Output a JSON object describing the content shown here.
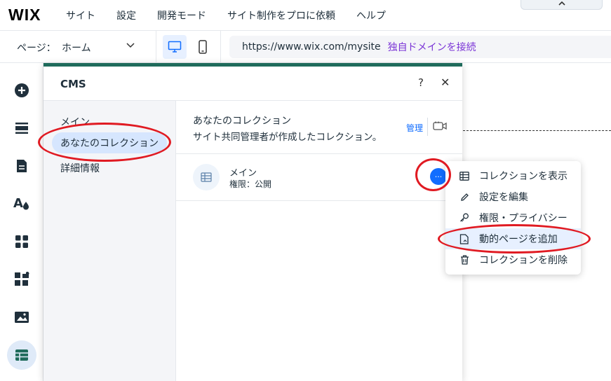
{
  "topbar": {
    "logo": "WIX",
    "menu": [
      "サイト",
      "設定",
      "開発モード",
      "サイト制作をプロに依頼",
      "ヘルプ"
    ],
    "collapse_icon": "chevron-up-icon"
  },
  "pagebar": {
    "page_label": "ページ：",
    "page_value": "ホーム",
    "url": "https://www.wix.com/mysite",
    "connect_domain": "独自ドメインを接続"
  },
  "rail": {
    "icons": [
      "add-icon",
      "sections-icon",
      "pages-icon",
      "design-icon",
      "apps-icon",
      "business-icon",
      "media-icon",
      "cms-icon"
    ]
  },
  "panel": {
    "title": "CMS",
    "help": "?",
    "close": "✕",
    "nav": {
      "main": "メイン",
      "your_collections": "あなたのコレクション",
      "details": "詳細情報"
    },
    "collections_header": {
      "title": "あなたのコレクション",
      "subtitle": "サイト共同管理者が作成したコレクション。",
      "manage": "管理"
    },
    "collection": {
      "name": "メイン",
      "permission": "権限：公開",
      "more": "···"
    }
  },
  "context_menu": {
    "items": [
      {
        "label": "コレクションを表示",
        "icon": "table-icon"
      },
      {
        "label": "設定を編集",
        "icon": "pencil-icon"
      },
      {
        "label": "権限・プライバシー",
        "icon": "key-icon"
      },
      {
        "label": "動的ページを追加",
        "icon": "dynamic-page-icon"
      },
      {
        "label": "コレクションを削除",
        "icon": "trash-icon"
      }
    ]
  },
  "colors": {
    "accent_blue": "#116dff",
    "panel_topline": "#1f6b5b",
    "annotation_red": "#e01a22",
    "domain_link": "#7a33d6"
  }
}
